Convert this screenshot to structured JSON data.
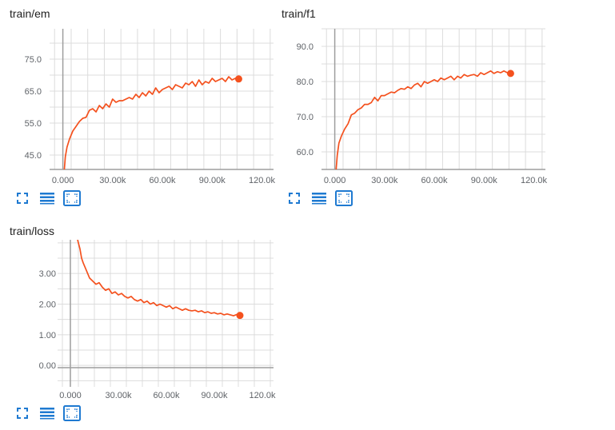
{
  "colors": {
    "accent": "#f4511e",
    "icon": "#1f7ad1",
    "grid": "#dcdcdc",
    "axis": "#9e9e9e"
  },
  "toolbar_icons": [
    "fullscreen-icon",
    "list-icon",
    "fit-domain-icon"
  ],
  "charts": {
    "em": {
      "title": "train/em"
    },
    "f1": {
      "title": "train/f1"
    },
    "loss": {
      "title": "train/loss"
    }
  },
  "chart_data": [
    {
      "id": "em",
      "type": "line",
      "title": "train/em",
      "xlabel": "",
      "ylabel": "",
      "xlim": [
        -8000,
        127000
      ],
      "ylim": [
        40.5,
        84.5
      ],
      "xticks": [
        0,
        30000,
        60000,
        90000,
        120000
      ],
      "xtick_labels": [
        "0.000",
        "30.00k",
        "60.00k",
        "90.00k",
        "120.0k"
      ],
      "yticks": [
        45,
        55,
        65,
        75
      ],
      "ytick_labels": [
        "45.0",
        "55.0",
        "65.0",
        "75.0"
      ],
      "grid": true,
      "series": [
        {
          "color": "#f4511e",
          "x": [
            800,
            1500,
            2500,
            4000,
            6000,
            8000,
            10000,
            12000,
            14000,
            16000,
            18000,
            20000,
            22000,
            24000,
            26000,
            28000,
            30000,
            32000,
            34000,
            36000,
            38000,
            40000,
            42000,
            44000,
            46000,
            48000,
            50000,
            52000,
            54000,
            56000,
            58000,
            60000,
            62000,
            64000,
            66000,
            68000,
            70000,
            72000,
            74000,
            76000,
            78000,
            80000,
            82000,
            84000,
            86000,
            88000,
            90000,
            92000,
            94000,
            96000,
            98000,
            100000,
            102000,
            104000,
            106000
          ],
          "y": [
            40,
            44.5,
            47.5,
            50,
            52.5,
            54,
            55.5,
            56.5,
            56.8,
            59,
            59.5,
            58.5,
            60.5,
            59.5,
            61,
            60,
            62.5,
            61.5,
            62,
            62,
            62.5,
            63,
            62.5,
            64,
            63,
            64.5,
            63.5,
            65,
            64,
            66,
            64.5,
            65.5,
            66,
            66.5,
            65.5,
            67,
            66.5,
            66,
            67.5,
            67,
            68,
            66.5,
            68.5,
            67,
            68,
            67.5,
            69,
            68,
            68.5,
            69,
            68,
            69.5,
            68.5,
            69,
            68.8
          ]
        }
      ],
      "end_marker": [
        106000,
        68.8
      ]
    },
    {
      "id": "f1",
      "type": "line",
      "title": "train/f1",
      "xlabel": "",
      "ylabel": "",
      "xlim": [
        -8000,
        127000
      ],
      "ylim": [
        55,
        95
      ],
      "xticks": [
        0,
        30000,
        60000,
        90000,
        120000
      ],
      "xtick_labels": [
        "0.000",
        "30.00k",
        "60.00k",
        "90.00k",
        "120.0k"
      ],
      "yticks": [
        60,
        70,
        80,
        90
      ],
      "ytick_labels": [
        "60.0",
        "70.0",
        "80.0",
        "90.0"
      ],
      "grid": true,
      "series": [
        {
          "color": "#f4511e",
          "x": [
            800,
            1500,
            2500,
            4000,
            6000,
            8000,
            10000,
            12000,
            14000,
            16000,
            18000,
            20000,
            22000,
            24000,
            26000,
            28000,
            30000,
            32000,
            34000,
            36000,
            38000,
            40000,
            42000,
            44000,
            46000,
            48000,
            50000,
            52000,
            54000,
            56000,
            58000,
            60000,
            62000,
            64000,
            66000,
            68000,
            70000,
            72000,
            74000,
            76000,
            78000,
            80000,
            82000,
            84000,
            86000,
            88000,
            90000,
            92000,
            94000,
            96000,
            98000,
            100000,
            102000,
            104000,
            106000
          ],
          "y": [
            55,
            59,
            62.5,
            64.5,
            66.5,
            68,
            70.5,
            71,
            72,
            72.5,
            73.5,
            73.5,
            74,
            75.5,
            74.5,
            76,
            76,
            76.5,
            77,
            76.8,
            77.5,
            78,
            77.8,
            78.5,
            78,
            79,
            79.5,
            78.5,
            80,
            79.5,
            80,
            80.5,
            80,
            81,
            80.5,
            81,
            81.5,
            80.5,
            81.5,
            81,
            82,
            81.5,
            81.8,
            82,
            81.5,
            82.5,
            82,
            82.5,
            83,
            82.3,
            82.8,
            82.5,
            83,
            82.5,
            82.3
          ]
        }
      ],
      "end_marker": [
        106000,
        82.3
      ]
    },
    {
      "id": "loss",
      "type": "line",
      "title": "train/loss",
      "xlabel": "",
      "ylabel": "",
      "xlim": [
        -8000,
        127000
      ],
      "ylim": [
        -0.7,
        4.1
      ],
      "xticks": [
        0,
        30000,
        60000,
        90000,
        120000
      ],
      "xtick_labels": [
        "0.000",
        "30.00k",
        "60.00k",
        "90.00k",
        "120.0k"
      ],
      "yticks": [
        0,
        1,
        2,
        3
      ],
      "ytick_labels": [
        "0.00",
        "1.00",
        "2.00",
        "3.00"
      ],
      "grid": true,
      "series": [
        {
          "color": "#f4511e",
          "x": [
            4500,
            6000,
            7000,
            8000,
            10000,
            12000,
            14000,
            16000,
            18000,
            20000,
            22000,
            24000,
            26000,
            28000,
            30000,
            32000,
            34000,
            36000,
            38000,
            40000,
            42000,
            44000,
            46000,
            48000,
            50000,
            52000,
            54000,
            56000,
            58000,
            60000,
            62000,
            64000,
            66000,
            68000,
            70000,
            72000,
            74000,
            76000,
            78000,
            80000,
            82000,
            84000,
            86000,
            88000,
            90000,
            92000,
            94000,
            96000,
            98000,
            100000,
            102000,
            104000,
            106000
          ],
          "y": [
            4.1,
            3.8,
            3.5,
            3.35,
            3.1,
            2.85,
            2.75,
            2.65,
            2.7,
            2.55,
            2.45,
            2.5,
            2.35,
            2.4,
            2.3,
            2.35,
            2.25,
            2.2,
            2.25,
            2.15,
            2.1,
            2.15,
            2.05,
            2.1,
            2.0,
            2.05,
            1.95,
            2.0,
            1.95,
            1.9,
            1.95,
            1.85,
            1.9,
            1.85,
            1.8,
            1.85,
            1.8,
            1.78,
            1.8,
            1.75,
            1.78,
            1.72,
            1.75,
            1.7,
            1.72,
            1.68,
            1.7,
            1.65,
            1.68,
            1.65,
            1.62,
            1.66,
            1.63
          ]
        }
      ],
      "end_marker": [
        106000,
        1.63
      ]
    }
  ]
}
